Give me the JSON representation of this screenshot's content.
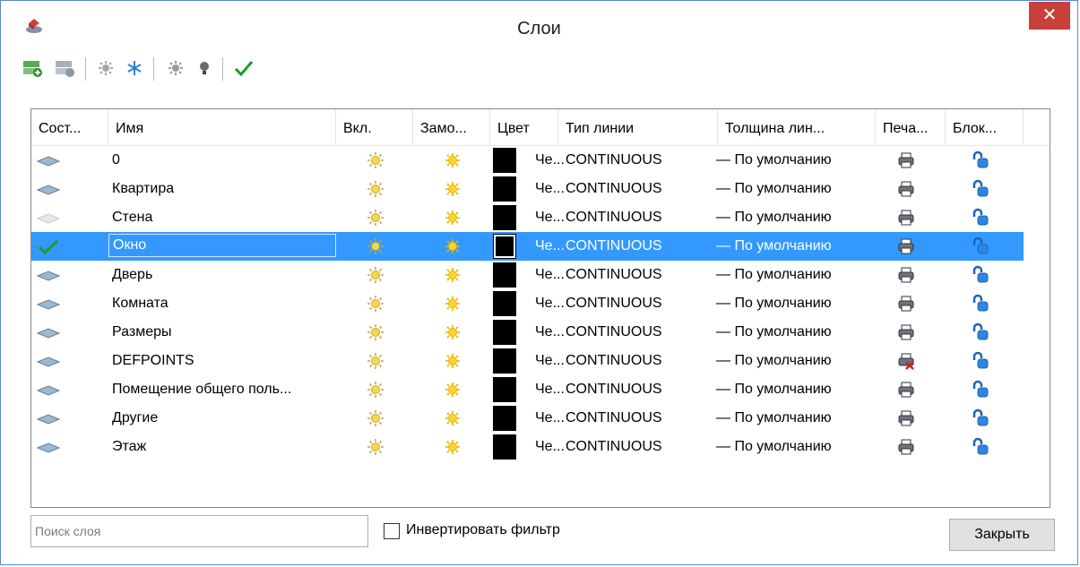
{
  "window": {
    "title": "Слои",
    "close_glyph": "✕"
  },
  "toolbar": {
    "buttons": [
      {
        "name": "new-layer-icon"
      },
      {
        "name": "delete-layer-icon"
      },
      {
        "name": "thaw-all-icon"
      },
      {
        "name": "freeze-all-icon"
      },
      {
        "name": "all-on-icon"
      },
      {
        "name": "isolate-icon"
      },
      {
        "name": "set-current-check-icon"
      }
    ]
  },
  "columns": [
    "Сост...",
    "Имя",
    "Вкл.",
    "Замо...",
    "Цвет",
    "Тип линии",
    "Толщина лин...",
    "Печа...",
    "Блок..."
  ],
  "layers": [
    {
      "name": "0",
      "color": "Че...",
      "linetype": "CONTINUOUS",
      "lineweight": "— По умолчанию",
      "current": false,
      "state": "normal",
      "plot": true
    },
    {
      "name": "Квартира",
      "color": "Че...",
      "linetype": "CONTINUOUS",
      "lineweight": "— По умолчанию",
      "current": false,
      "state": "normal",
      "plot": true
    },
    {
      "name": "Стена",
      "color": "Че...",
      "linetype": "CONTINUOUS",
      "lineweight": "— По умолчанию",
      "current": false,
      "state": "faded",
      "plot": true
    },
    {
      "name": "Окно",
      "color": "Че...",
      "linetype": "CONTINUOUS",
      "lineweight": "— По умолчанию",
      "current": true,
      "state": "current",
      "plot": true
    },
    {
      "name": "Дверь",
      "color": "Че...",
      "linetype": "CONTINUOUS",
      "lineweight": "— По умолчанию",
      "current": false,
      "state": "normal",
      "plot": true
    },
    {
      "name": "Комната",
      "color": "Че...",
      "linetype": "CONTINUOUS",
      "lineweight": "— По умолчанию",
      "current": false,
      "state": "normal",
      "plot": true
    },
    {
      "name": "Размеры",
      "color": "Че...",
      "linetype": "CONTINUOUS",
      "lineweight": "— По умолчанию",
      "current": false,
      "state": "normal",
      "plot": true
    },
    {
      "name": "DEFPOINTS",
      "color": "Че...",
      "linetype": "CONTINUOUS",
      "lineweight": "— По умолчанию",
      "current": false,
      "state": "normal",
      "plot": false
    },
    {
      "name": "Помещение общего поль...",
      "color": "Че...",
      "linetype": "CONTINUOUS",
      "lineweight": "— По умолчанию",
      "current": false,
      "state": "normal",
      "plot": true
    },
    {
      "name": "Другие",
      "color": "Че...",
      "linetype": "CONTINUOUS",
      "lineweight": "— По умолчанию",
      "current": false,
      "state": "normal",
      "plot": true
    },
    {
      "name": "Этаж",
      "color": "Че...",
      "linetype": "CONTINUOUS",
      "lineweight": "— По умолчанию",
      "current": false,
      "state": "normal",
      "plot": true
    }
  ],
  "footer": {
    "search_placeholder": "Поиск слоя",
    "invert_label": "Инвертировать фильтр",
    "close_label": "Закрыть"
  },
  "colors": {
    "selection": "#3399ff",
    "close_button": "#c7403a",
    "layer_color": "#000000"
  }
}
